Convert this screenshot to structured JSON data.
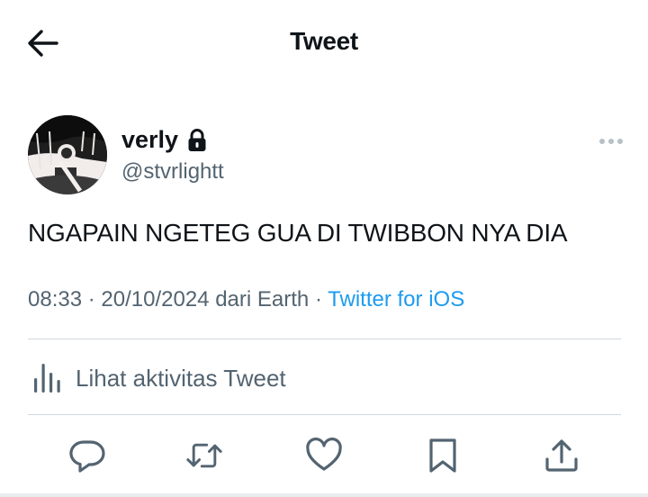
{
  "header": {
    "title": "Tweet",
    "back_icon": "arrow-left-icon"
  },
  "author": {
    "name": "verly",
    "handle": "@stvrlightt",
    "protected_icon": "lock-icon",
    "avatar": "avatar-image"
  },
  "tweet": {
    "text": "NGAPAIN NGETEG GUA DI TWIBBON NYA DIA",
    "time": "08:33",
    "separator": "·",
    "date": "20/10/2024",
    "location": "dari Earth",
    "source": "Twitter for iOS"
  },
  "activity": {
    "label": "Lihat aktivitas Tweet",
    "icon": "bar-chart-icon"
  },
  "actions": [
    {
      "name": "reply",
      "icon": "reply-icon"
    },
    {
      "name": "retweet",
      "icon": "retweet-icon"
    },
    {
      "name": "like",
      "icon": "heart-icon"
    },
    {
      "name": "bookmark",
      "icon": "bookmark-icon"
    },
    {
      "name": "share",
      "icon": "share-icon"
    }
  ],
  "colors": {
    "text": "#0f1419",
    "secondary": "#536471",
    "link": "#1d9bf0",
    "divider": "#cfd9de"
  }
}
